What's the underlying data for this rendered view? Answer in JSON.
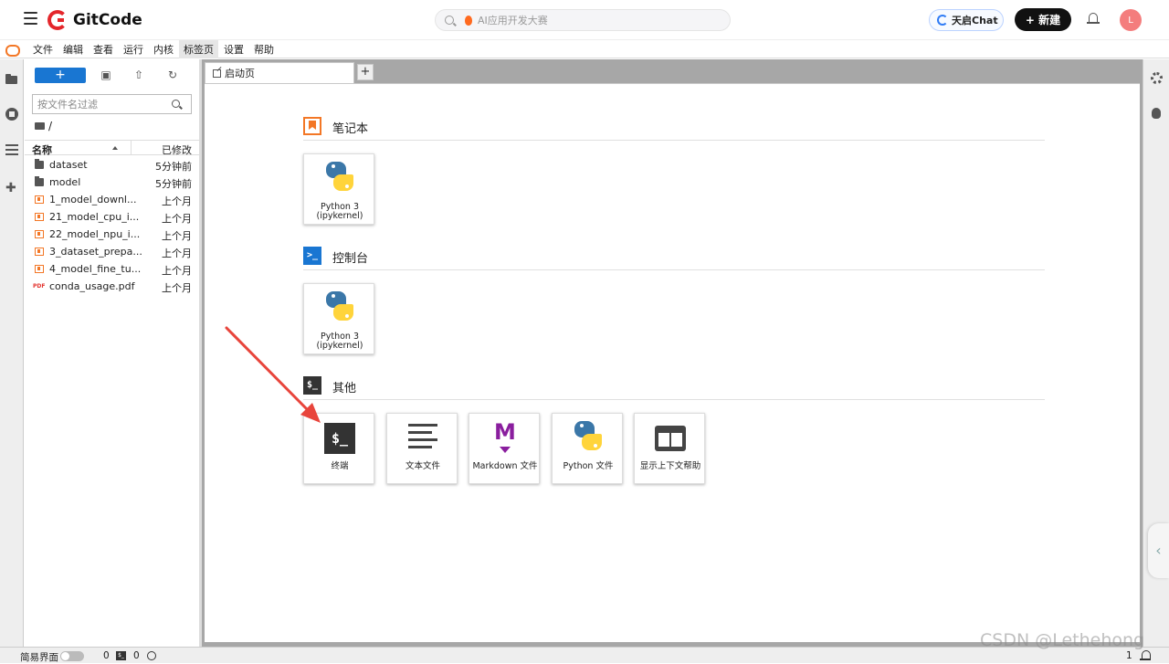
{
  "header": {
    "brand": "GitCode",
    "search_placeholder": "AI应用开发大赛",
    "chat_label": "天启Chat",
    "new_label": "+ 新建",
    "avatar_letter": "L"
  },
  "menubar": {
    "items": [
      "文件",
      "编辑",
      "查看",
      "运行",
      "内核",
      "标签页",
      "设置",
      "帮助"
    ]
  },
  "filebrowser": {
    "new_label": "+",
    "filter_placeholder": "按文件名过滤",
    "breadcrumb": "/",
    "col_name": "名称",
    "col_modified": "已修改",
    "files": [
      {
        "type": "folder",
        "name": "dataset",
        "modified": "5分钟前"
      },
      {
        "type": "folder",
        "name": "model",
        "modified": "5分钟前"
      },
      {
        "type": "notebook",
        "name": "1_model_downl...",
        "modified": "上个月"
      },
      {
        "type": "notebook",
        "name": "21_model_cpu_i...",
        "modified": "上个月"
      },
      {
        "type": "notebook",
        "name": "22_model_npu_i...",
        "modified": "上个月"
      },
      {
        "type": "notebook",
        "name": "3_dataset_prepa...",
        "modified": "上个月"
      },
      {
        "type": "notebook",
        "name": "4_model_fine_tu...",
        "modified": "上个月"
      },
      {
        "type": "pdf",
        "name": "conda_usage.pdf",
        "modified": "上个月"
      }
    ]
  },
  "tabs": {
    "launcher_tab": "启动页",
    "add": "+"
  },
  "launcher": {
    "notebook_title": "笔记本",
    "console_title": "控制台",
    "other_title": "其他",
    "console_icon_text": ">_",
    "other_icon_text": "$_",
    "notebook_card": {
      "line1": "Python 3",
      "line2": "(ipykernel)"
    },
    "console_card": {
      "line1": "Python 3",
      "line2": "(ipykernel)"
    },
    "other_cards": {
      "terminal": "终端",
      "text_file": "文本文件",
      "markdown": "Markdown 文件",
      "python": "Python 文件",
      "context_help": "显示上下文帮助"
    },
    "terminal_glyph": "$_",
    "markdown_glyph": "M"
  },
  "statusbar": {
    "simple_mode": "简易界面",
    "terminals": "0",
    "terminal_glyph": "$_",
    "kernels": "0",
    "right_count": "1"
  },
  "watermark": "CSDN @Lethehong",
  "colors": {
    "jupyter_orange": "#f37726",
    "accent_blue": "#1976d2",
    "gitcode_red": "#e4262b",
    "annotation_arrow": "#e8453c"
  }
}
